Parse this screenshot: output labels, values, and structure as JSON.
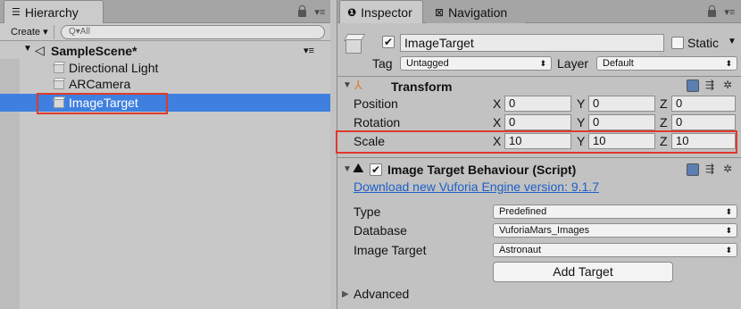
{
  "hierarchy": {
    "tab_label": "Hierarchy",
    "create_label": "Create ▾",
    "search_placeholder": "Q▾All",
    "scene_name": "SampleScene*",
    "items": [
      {
        "label": "Directional Light"
      },
      {
        "label": "ARCamera"
      },
      {
        "label": "ImageTarget",
        "selected": true
      }
    ]
  },
  "inspector": {
    "tabs": [
      {
        "label": "Inspector",
        "active": true
      },
      {
        "label": "Navigation",
        "active": false
      }
    ],
    "object_name": "ImageTarget",
    "static_label": "Static",
    "tag_label": "Tag",
    "tag_value": "Untagged",
    "layer_label": "Layer",
    "layer_value": "Default",
    "transform": {
      "title": "Transform",
      "rows": [
        {
          "label": "Position",
          "x": "0",
          "y": "0",
          "z": "0"
        },
        {
          "label": "Rotation",
          "x": "0",
          "y": "0",
          "z": "0"
        },
        {
          "label": "Scale",
          "x": "10",
          "y": "10",
          "z": "10"
        }
      ],
      "axes": {
        "x": "X",
        "y": "Y",
        "z": "Z"
      }
    },
    "script": {
      "title": "Image Target Behaviour (Script)",
      "download_link": "Download new Vuforia Engine version: 9.1.7",
      "type_label": "Type",
      "type_value": "Predefined",
      "database_label": "Database",
      "database_value": "VuforiaMars_Images",
      "image_target_label": "Image Target",
      "image_target_value": "Astronaut",
      "add_target_button": "Add Target"
    },
    "advanced_label": "Advanced"
  },
  "colors": {
    "selection": "#3f7fe0",
    "highlight_box": "#e0392b",
    "link": "#1f5fc7"
  }
}
